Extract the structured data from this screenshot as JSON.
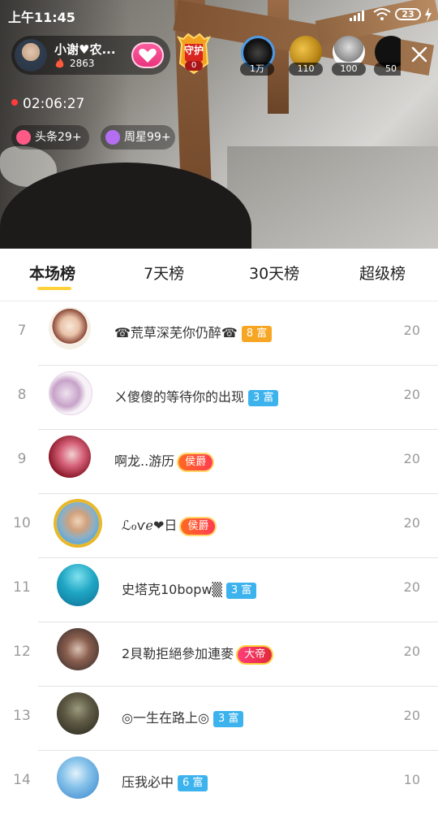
{
  "status_bar": {
    "time": "上午11:45",
    "battery": "23"
  },
  "anchor": {
    "name": "小谢♥农...",
    "heat": "2863"
  },
  "guard": {
    "label": "守护",
    "count": "0"
  },
  "viewers": [
    "1万",
    "110",
    "100",
    "50"
  ],
  "live": {
    "duration": "02:06:27"
  },
  "chips": {
    "headline": "头条29+",
    "weekstar": "周星99+"
  },
  "tabs": [
    "本场榜",
    "7天榜",
    "30天榜",
    "超级榜"
  ],
  "ranking": [
    {
      "rank": "7",
      "name": "☎荒草深芜你仍醉☎",
      "badge": "8 富",
      "badge_type": "orange",
      "score": "20"
    },
    {
      "rank": "8",
      "name": "ㄨ傻傻的等待你的出现",
      "badge": "3 富",
      "badge_type": "blue",
      "score": "20"
    },
    {
      "rank": "9",
      "name": "啊龙..游历",
      "badge": "侯爵",
      "badge_type": "noble",
      "score": "20"
    },
    {
      "rank": "10",
      "name": "ℒℴѵℯ❤日",
      "badge": "侯爵",
      "badge_type": "noble",
      "score": "20"
    },
    {
      "rank": "11",
      "name": "史塔克10bopw▒",
      "badge": "3 富",
      "badge_type": "blue",
      "score": "20"
    },
    {
      "rank": "12",
      "name": "2貝勒拒絕參加連麥",
      "badge": "大帝",
      "badge_type": "emperor",
      "score": "20"
    },
    {
      "rank": "13",
      "name": "◎一生在路上◎",
      "badge": "3 富",
      "badge_type": "blue",
      "score": "20"
    },
    {
      "rank": "14",
      "name": "压我必中",
      "badge": "6 富",
      "badge_type": "blue",
      "score": "10"
    }
  ]
}
